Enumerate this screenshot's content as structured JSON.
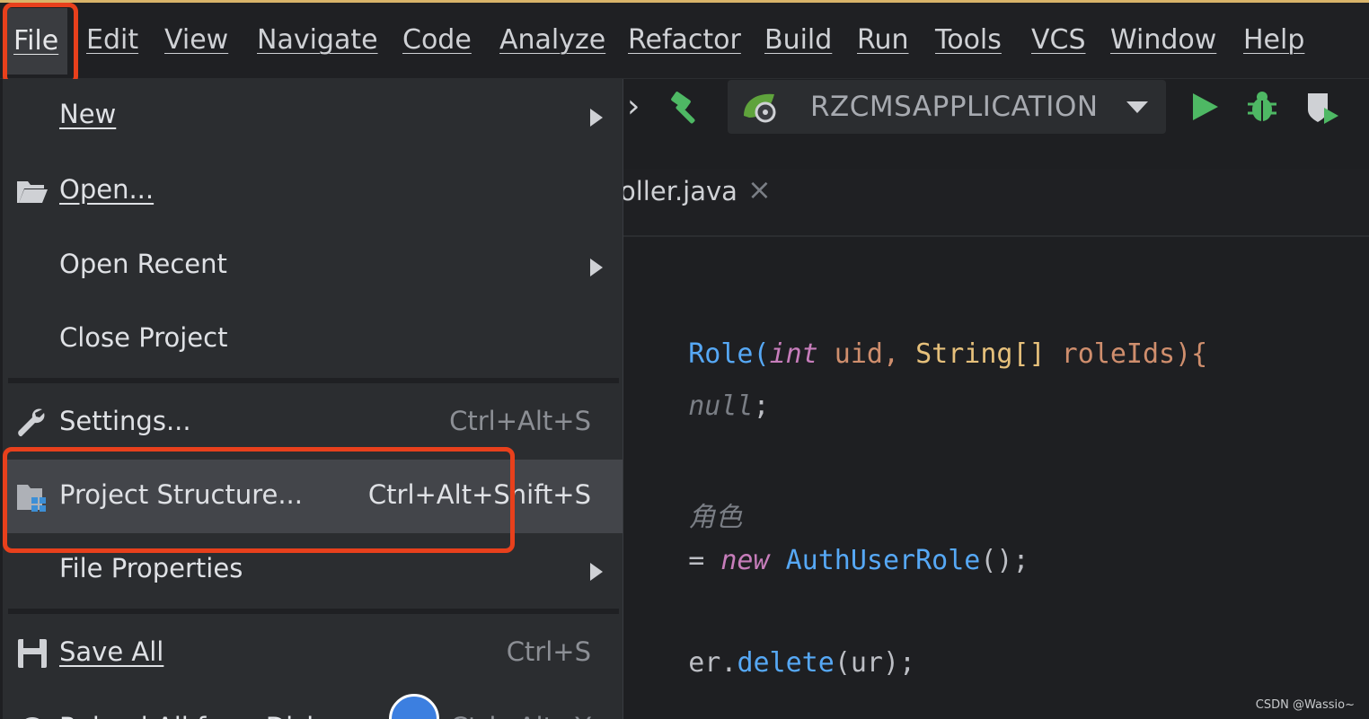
{
  "menubar": {
    "items": [
      "File",
      "Edit",
      "View",
      "Navigate",
      "Code",
      "Analyze",
      "Refactor",
      "Build",
      "Run",
      "Tools",
      "VCS",
      "Window",
      "Help"
    ],
    "active": "File"
  },
  "toolbar": {
    "run_config": "RZCMSAPPLICATION"
  },
  "editor": {
    "tab_label": "oller.java",
    "tab_close": "×",
    "code": {
      "line1": {
        "a": "Role(",
        "b": "int",
        "c": " uid, ",
        "d": "String[]",
        "e": " roleIds){"
      },
      "line2": {
        "a": "null",
        "b": ";"
      },
      "line3": {
        "a": "角色"
      },
      "line4": {
        "a": "= ",
        "b": "new",
        "c": " ",
        "d": "AuthUserRole",
        "e": "();"
      },
      "line5": {
        "a": "er.",
        "b": "delete",
        "c": "(ur);"
      }
    }
  },
  "file_menu": {
    "new": "New",
    "open": "Open...",
    "open_recent": "Open Recent",
    "close_project": "Close Project",
    "settings": "Settings...",
    "settings_shortcut": "Ctrl+Alt+S",
    "project_structure": "Project Structure...",
    "project_structure_shortcut": "Ctrl+Alt+Shift+S",
    "file_properties": "File Properties",
    "save_all": "Save All",
    "save_all_shortcut": "Ctrl+S",
    "partial_next": "Reload All from Disk",
    "partial_next_shortcut": "Ctrl+Alt+Y"
  },
  "colors": {
    "highlight_border": "#e8401c",
    "run_green": "#4eb864",
    "menu_bg": "#2b2d30",
    "selected_bg": "#43454a"
  },
  "watermark": "CSDN @Wassio~"
}
